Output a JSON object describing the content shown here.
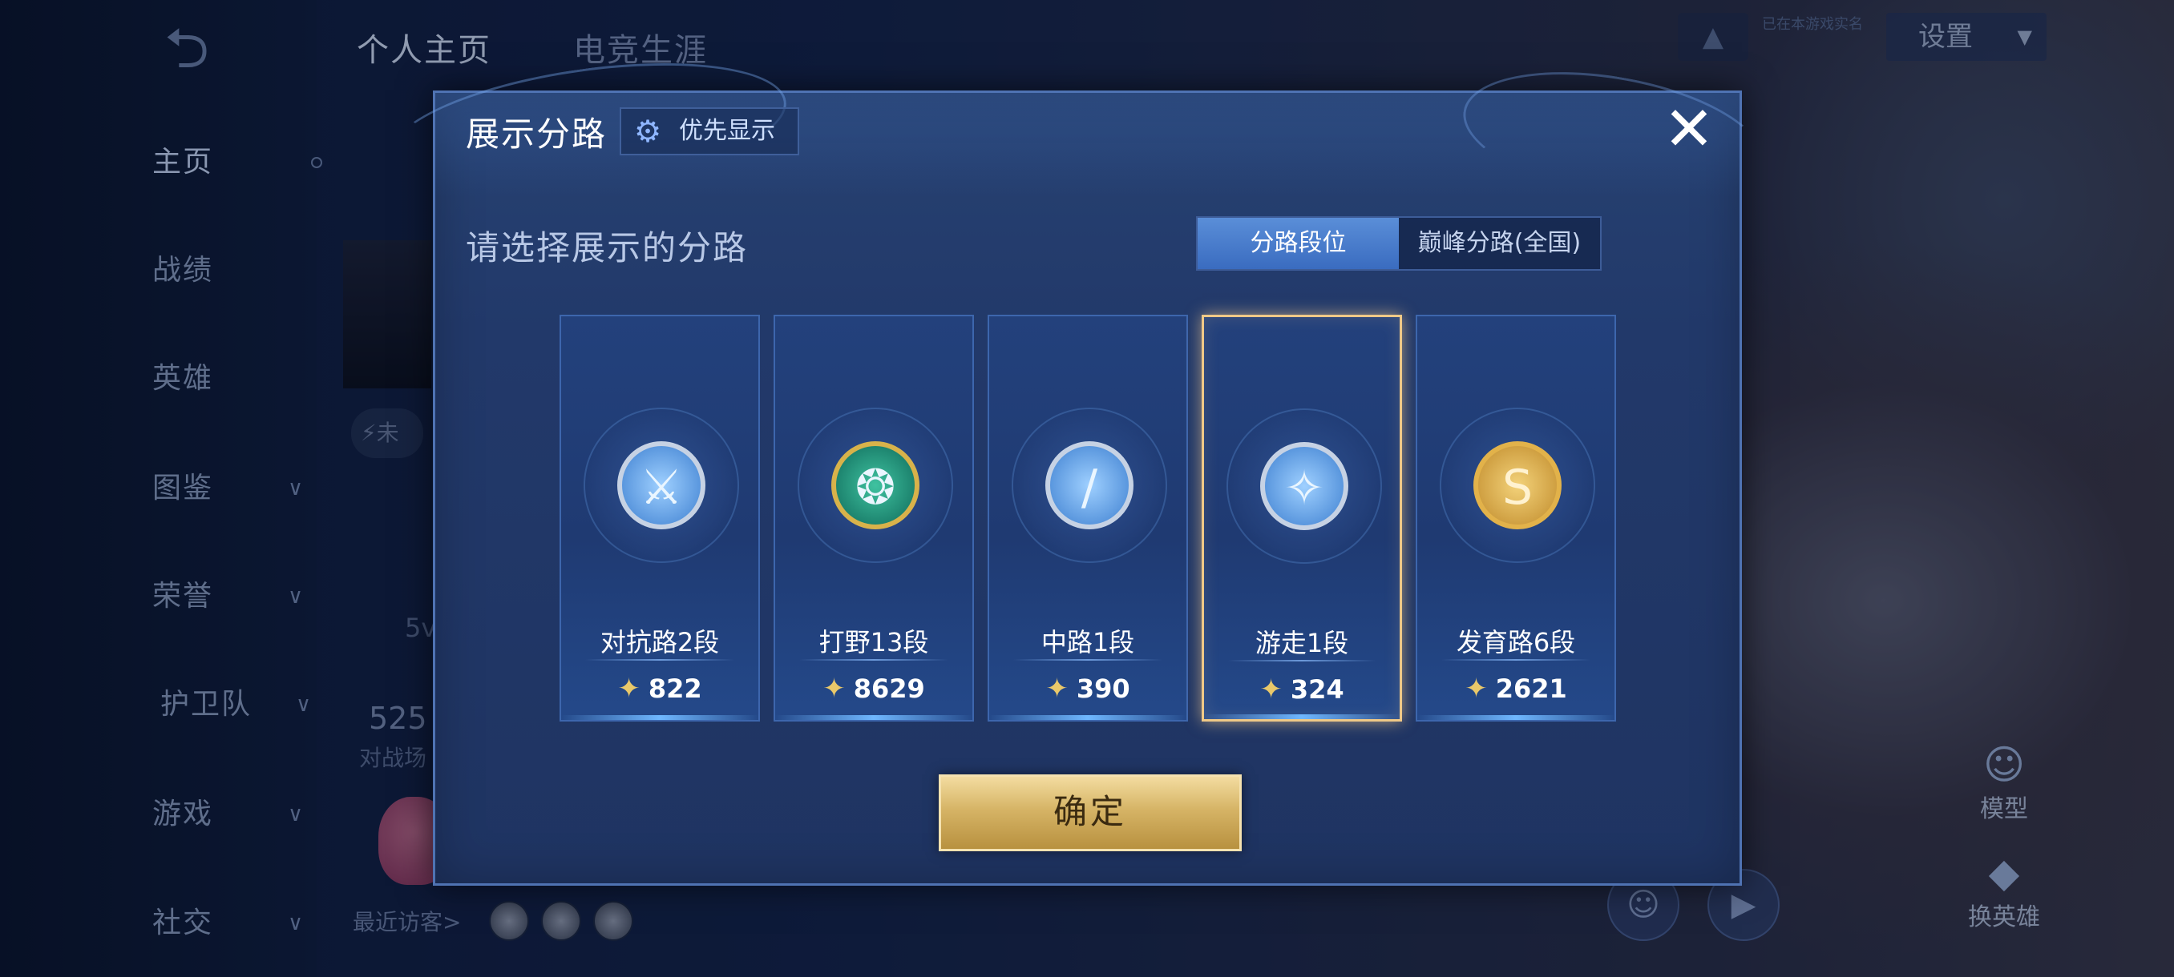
{
  "background": {
    "back_icon": "back-arrow-icon",
    "top_tabs": [
      "个人主页",
      "电竞生涯"
    ],
    "top_right_note": "已在本游戏实名",
    "settings_label": "设置",
    "sidebar": [
      {
        "label": "主页",
        "active": true,
        "chevron": false
      },
      {
        "label": "战绩",
        "active": false,
        "chevron": false
      },
      {
        "label": "英雄",
        "active": false,
        "chevron": false
      },
      {
        "label": "图鉴",
        "active": false,
        "chevron": true
      },
      {
        "label": "荣誉",
        "active": false,
        "chevron": true
      },
      {
        "label": "护卫队",
        "active": false,
        "chevron": true
      },
      {
        "label": "游戏",
        "active": false,
        "chevron": true
      },
      {
        "label": "社交",
        "active": false,
        "chevron": true
      }
    ],
    "profile_badge": "未",
    "profile_text_1": "5v",
    "profile_count": "525",
    "profile_caption": "对战场",
    "recent_visitors": "最近访客>",
    "right_buttons": [
      "模型",
      "换英雄"
    ]
  },
  "modal": {
    "title": "展示分路",
    "priority_label": "优先显示",
    "close_icon": "close-icon",
    "subtitle": "请选择展示的分路",
    "segments": [
      {
        "label": "分路段位",
        "active": true
      },
      {
        "label": "巅峰分路(全国)",
        "active": false
      }
    ],
    "cards": [
      {
        "label": "对抗路2段",
        "score": "822",
        "icon": "crossed-swords-icon",
        "selected": false
      },
      {
        "label": "打野13段",
        "score": "8629",
        "icon": "dragon-icon",
        "selected": false
      },
      {
        "label": "中路1段",
        "score": "390",
        "icon": "staff-icon",
        "selected": false
      },
      {
        "label": "游走1段",
        "score": "324",
        "icon": "wings-icon",
        "selected": true
      },
      {
        "label": "发育路6段",
        "score": "2621",
        "icon": "bow-icon",
        "selected": false
      }
    ],
    "confirm_label": "确定"
  }
}
